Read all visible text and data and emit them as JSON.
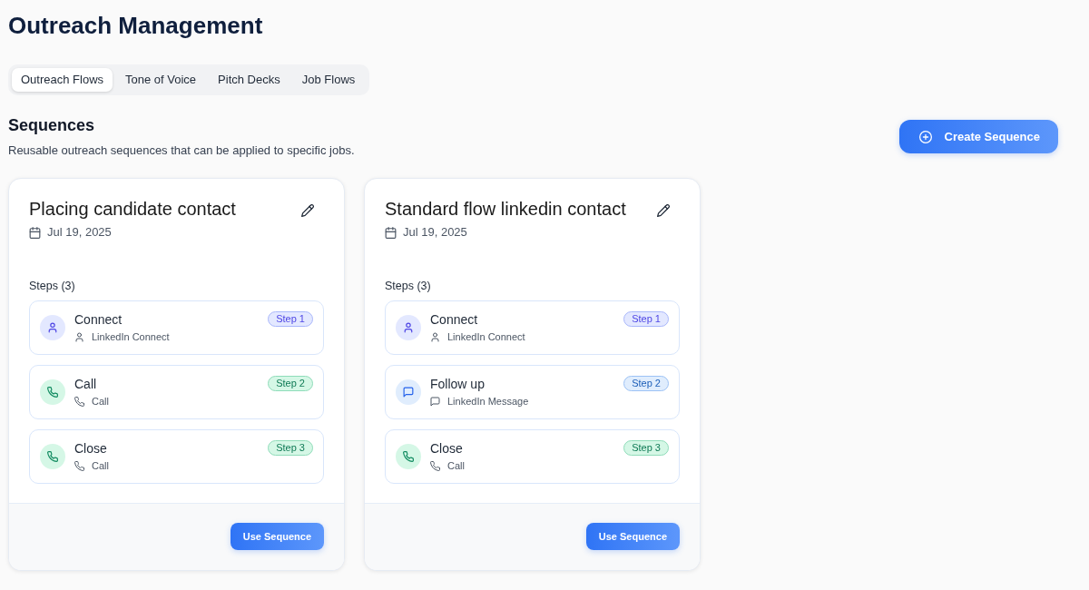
{
  "title": "Outreach Management",
  "tabs": [
    {
      "label": "Outreach Flows",
      "selected": true
    },
    {
      "label": "Tone of Voice",
      "selected": false
    },
    {
      "label": "Pitch Decks",
      "selected": false
    },
    {
      "label": "Job Flows",
      "selected": false
    }
  ],
  "section": {
    "heading": "Sequences",
    "description": "Reusable outreach sequences that can be applied to specific jobs.",
    "create_button": "Create Sequence"
  },
  "sequences": [
    {
      "title": "Placing candidate contact",
      "date": "Jul 19, 2025",
      "steps_label": "Steps (3)",
      "steps": [
        {
          "kind": "connect",
          "name": "Connect",
          "channel": "LinkedIn Connect",
          "badge": "Step 1"
        },
        {
          "kind": "call",
          "name": "Call",
          "channel": "Call",
          "badge": "Step 2"
        },
        {
          "kind": "call",
          "name": "Close",
          "channel": "Call",
          "badge": "Step 3"
        }
      ],
      "action_button": "Use Sequence"
    },
    {
      "title": "Standard flow linkedin contact",
      "date": "Jul 19, 2025",
      "steps_label": "Steps (3)",
      "steps": [
        {
          "kind": "connect",
          "name": "Connect",
          "channel": "LinkedIn Connect",
          "badge": "Step 1"
        },
        {
          "kind": "message",
          "name": "Follow up",
          "channel": "LinkedIn Message",
          "badge": "Step 2"
        },
        {
          "kind": "call",
          "name": "Close",
          "channel": "Call",
          "badge": "Step 3"
        }
      ],
      "action_button": "Use Sequence"
    }
  ]
}
